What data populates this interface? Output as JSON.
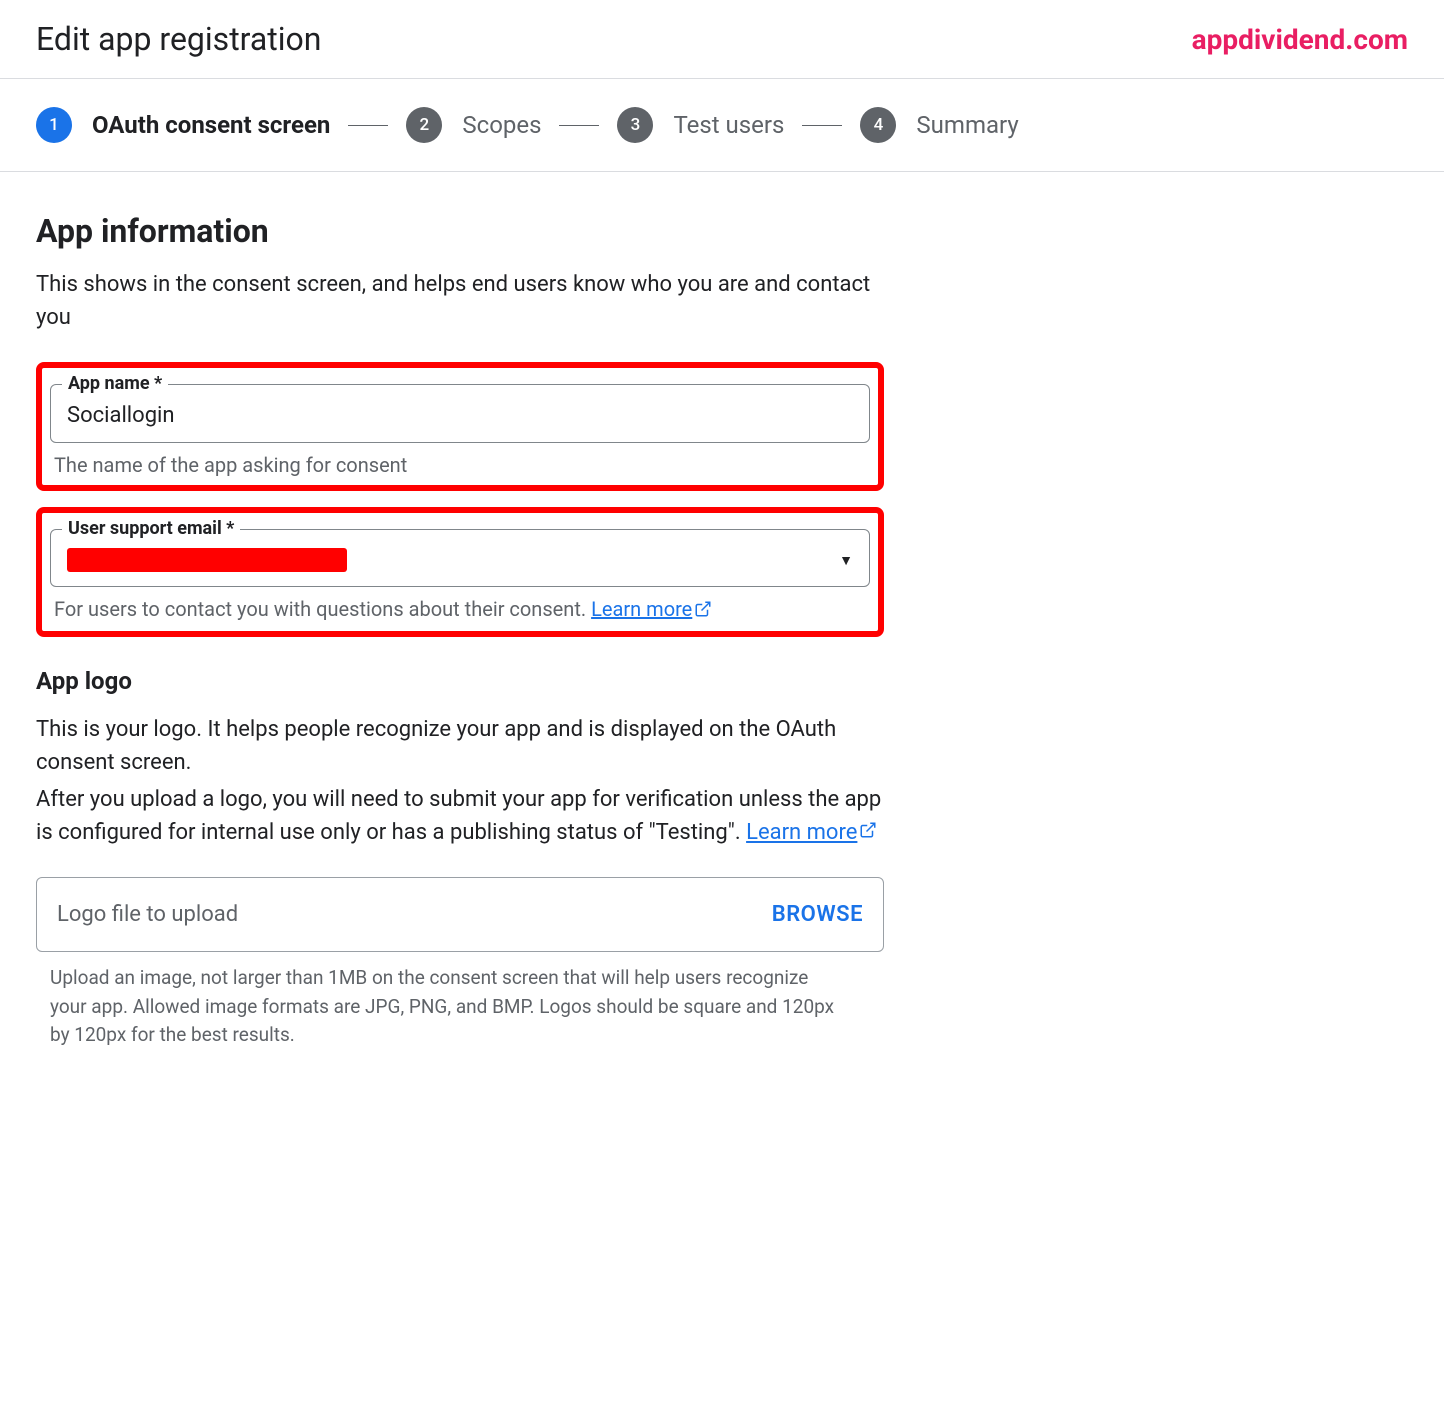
{
  "header": {
    "title": "Edit app registration",
    "watermark": "appdividend.com"
  },
  "stepper": {
    "steps": [
      {
        "num": "1",
        "label": "OAuth consent screen",
        "active": true
      },
      {
        "num": "2",
        "label": "Scopes",
        "active": false
      },
      {
        "num": "3",
        "label": "Test users",
        "active": false
      },
      {
        "num": "4",
        "label": "Summary",
        "active": false
      }
    ]
  },
  "app_info": {
    "heading": "App information",
    "desc": "This shows in the consent screen, and helps end users know who you are and contact you",
    "app_name": {
      "label": "App name *",
      "value": "Sociallogin",
      "help": "The name of the app asking for consent"
    },
    "support_email": {
      "label": "User support email *",
      "value": "",
      "help_prefix": "For users to contact you with questions about their consent. ",
      "learn_more": "Learn more"
    }
  },
  "app_logo": {
    "heading": "App logo",
    "desc_p1": "This is your logo. It helps people recognize your app and is displayed on the OAuth consent screen.",
    "desc_p2_prefix": "After you upload a logo, you will need to submit your app for verification unless the app is configured for internal use only or has a publishing status of \"Testing\". ",
    "learn_more": "Learn more",
    "upload_label": "Logo file to upload",
    "browse": "BROWSE",
    "upload_help": "Upload an image, not larger than 1MB on the consent screen that will help users recognize your app. Allowed image formats are JPG, PNG, and BMP. Logos should be square and 120px by 120px for the best results."
  }
}
